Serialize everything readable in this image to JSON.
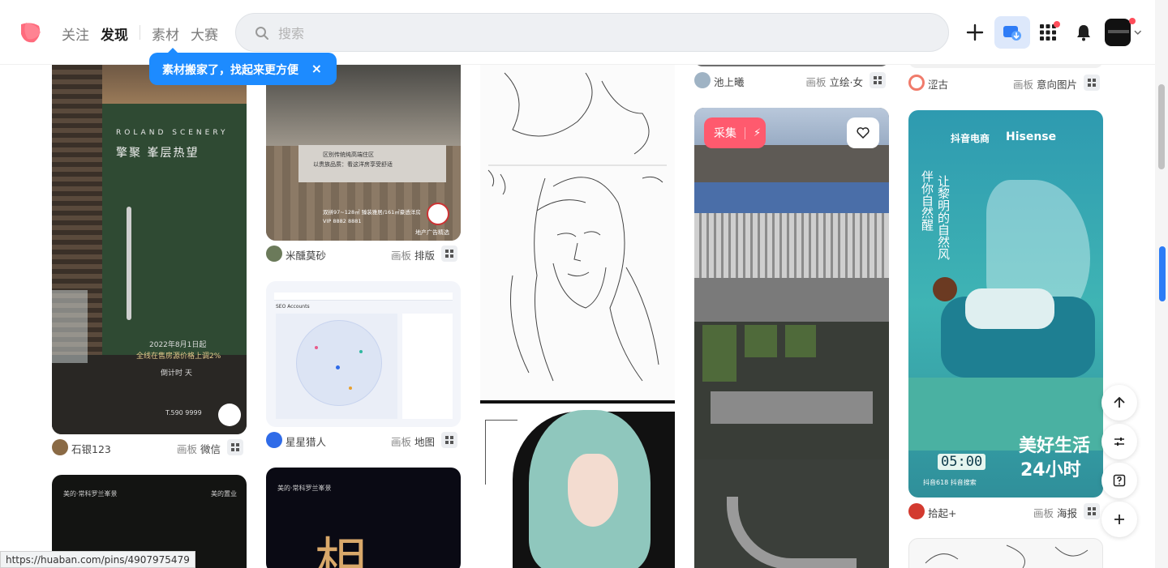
{
  "header": {
    "nav": [
      {
        "label": "关注"
      },
      {
        "label": "发现",
        "active": true
      },
      {
        "label": "素材"
      },
      {
        "label": "大赛"
      }
    ],
    "search_placeholder": "搜索"
  },
  "tooltip": {
    "text": "素材搬家了，找起来更方便",
    "close": "×"
  },
  "pins": {
    "p1": {
      "title1": "ROLAND SCENERY",
      "title2": "擎聚  峯层热望",
      "date_text": "2022年8月1日起",
      "price_text": "全线在售房源价格上调2%",
      "countdown": "倒计时  天",
      "phone": "T.590 9999",
      "user": "石银123",
      "board_prefix": "画板",
      "board": "微信"
    },
    "p2": {
      "banner1": "区别传统纯高端住区",
      "banner2": "以贵族品质：看这洋房享受舒适",
      "area_text": "双拼97~128㎡ 臻装雅居/161㎡豪透洋房",
      "vip_text": "VIP 8882 8881",
      "badge": "地产广告精选",
      "user": "米醺莫砂",
      "board_prefix": "画板",
      "board": "排版"
    },
    "p3": {
      "app_title": "SEO Accounts",
      "user": "星星猎人",
      "board_prefix": "画板",
      "board": "地图"
    },
    "p4": {
      "header_left": "美的·常科罗兰峯景",
      "header_right": "美的置业"
    },
    "p5": {
      "header_left": "美的·常科罗兰峯景",
      "big_text": "相"
    },
    "p6": {
      "user": "池上曦",
      "board_prefix": "画板",
      "board": "立绘·女"
    },
    "p7": {
      "collect_label": "采集"
    },
    "p8": {
      "brand_left": "抖音电商",
      "brand_right": "Hisense",
      "vert1": "让黎明的自然风",
      "vert2": "伴你自然醒",
      "slogan1": "美好生活",
      "slogan2": "24小时",
      "time": "05:00",
      "footer": "抖音618  抖音搜索",
      "user": "拾起+",
      "board_prefix": "画板",
      "board": "海报"
    },
    "p9": {
      "user": "涩古",
      "board_prefix": "画板",
      "board": "意向图片"
    }
  },
  "status_url": "https://huaban.com/pins/4907975479",
  "colors": {
    "accent": "#ff5a6e",
    "tooltip": "#1d8bff"
  },
  "icons": [
    "logo-icon",
    "search-icon",
    "plus-icon",
    "download-icon",
    "apps-icon",
    "bell-icon",
    "arrow-up-icon",
    "filter-icon",
    "help-icon",
    "add-icon",
    "heart-icon",
    "flash-icon",
    "board-icon"
  ]
}
